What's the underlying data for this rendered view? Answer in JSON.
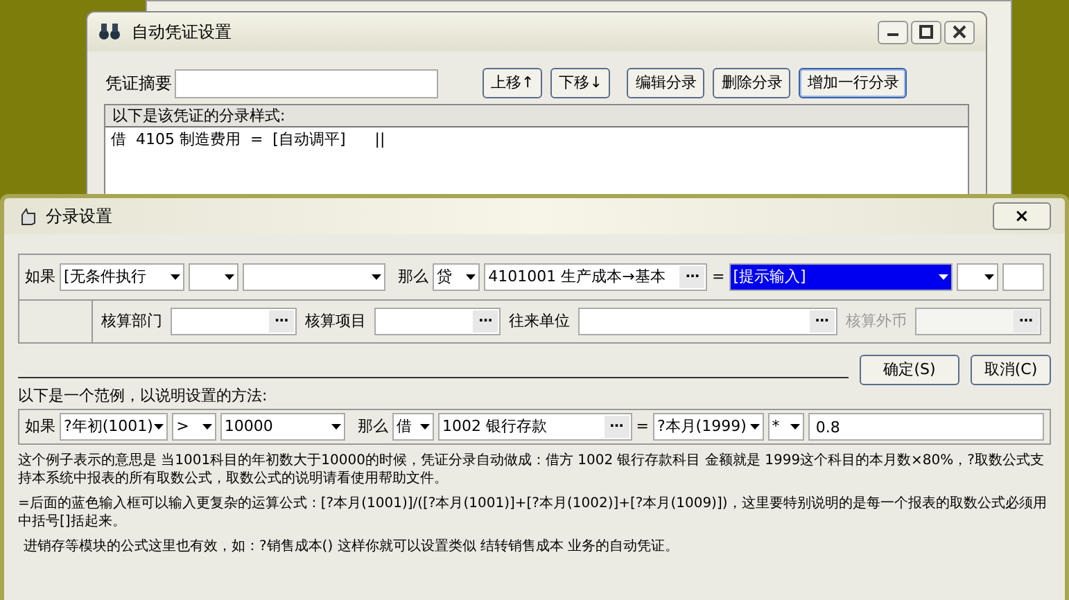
{
  "voucher_window": {
    "title": "自动凭证设置",
    "summary_label": "凭证摘要",
    "buttons": [
      {
        "label": "上移↑",
        "default": false
      },
      {
        "label": "下移↓",
        "default": false
      },
      {
        "label": "编辑分录",
        "default": false
      },
      {
        "label": "删除分录",
        "default": false
      },
      {
        "label": "增加一行分录",
        "default": true
      }
    ],
    "list_header": "以下是该凭证的分录样式:",
    "entries": [
      {
        "direction": "借",
        "code": "4105",
        "name": "制造费用",
        "eq": "=",
        "amount": "[自动调平]",
        "tail": "||"
      }
    ]
  },
  "entry_dialog": {
    "title": "分录设置",
    "close": "×",
    "rule": {
      "if_label": "如果",
      "condition": "[无条件执行",
      "then_label": "那么",
      "direction": "贷",
      "account": "4101001 生产成本→基本",
      "browse": "…",
      "eq": "=",
      "formula": "[提示输入]"
    },
    "aux": [
      {
        "label": "核算部门",
        "browse": "…",
        "disabled": false
      },
      {
        "label": "核算项目",
        "browse": "…",
        "disabled": false
      },
      {
        "label": "往来单位",
        "browse": "…",
        "disabled": false
      },
      {
        "label": "核算外币",
        "browse": "…",
        "disabled": true
      }
    ],
    "ok": "确定(S)",
    "cancel": "取消(C)",
    "example_label": "以下是一个范例，以说明设置的方法:",
    "example": {
      "if_label": "如果",
      "condition": "?年初(1001)",
      "operator": ">",
      "operand": "10000",
      "then_label": "那么",
      "direction": "借",
      "account": "1002 银行存款",
      "browse": "…",
      "eq": "=",
      "formula": "?本月(1999)",
      "op2": "*",
      "factor": "0.8"
    },
    "notes": [
      "这个例子表示的意思是 当1001科目的年初数大于10000的时候，凭证分录自动做成：借方 1002 银行存款科目 金额就是 1999这个科目的本月数×80%，?取数公式支持本系统中报表的所有取数公式，取数公式的说明请看使用帮助文件。",
      "=后面的蓝色输入框可以输入更复杂的运算公式：[?本月(1001)]/([?本月(1001)]+[?本月(1002)]+[?本月(1009)])，这里要特别说明的是每一个报表的取数公式必须用中括号[]括起来。",
      "进销存等模块的公式这里也有效，如：?销售成本()  这样你就可以设置类似 结转销售成本 业务的自动凭证。"
    ]
  }
}
